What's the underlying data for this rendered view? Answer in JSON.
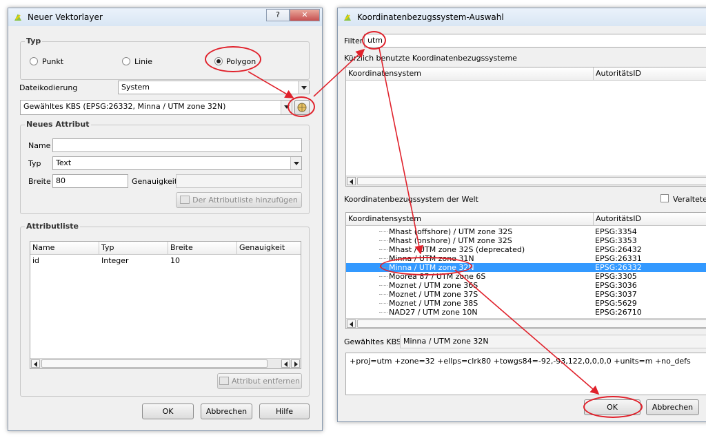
{
  "vector_dialog": {
    "title": "Neuer Vektorlayer",
    "help_glyph": "?",
    "close_glyph": "✕",
    "typ_group": "Typ",
    "types": [
      "Punkt",
      "Linie",
      "Polygon"
    ],
    "selected_type": "Polygon",
    "encoding_label": "Dateikodierung",
    "encoding_value": "System",
    "crs_value": "Gewähltes KBS (EPSG:26332, Minna / UTM zone 32N)",
    "new_attr_group": "Neues Attribut",
    "name_label": "Name",
    "name_value": "",
    "type_label": "Typ",
    "type_value": "Text",
    "width_label": "Breite",
    "width_value": "80",
    "precision_label": "Genauigkeit",
    "precision_value": "",
    "add_attr_button": "Der Attributliste hinzufügen",
    "attr_list_group": "Attributliste",
    "attr_columns": [
      "Name",
      "Typ",
      "Breite",
      "Genauigkeit"
    ],
    "attr_rows": [
      [
        "id",
        "Integer",
        "10",
        ""
      ]
    ],
    "remove_attr_button": "Attribut entfernen",
    "ok": "OK",
    "cancel": "Abbrechen",
    "help": "Hilfe"
  },
  "crs_dialog": {
    "title": "Koordinatenbezugssystem-Auswahl",
    "filter_label": "Filter",
    "filter_value": "utm",
    "recent_label": "Kürzlich benutzte Koordinatenbezugssysteme",
    "recent_columns": [
      "Koordinatensystem",
      "AutoritätsID"
    ],
    "world_label": "Koordinatenbezugssystem der Welt",
    "deprecated_label": "Veraltete K",
    "world_columns": [
      "Koordinatensystem",
      "AutoritätsID"
    ],
    "world_rows": [
      {
        "name": "Mhast (offshore) / UTM zone 32S",
        "id": "EPSG:3354",
        "selected": false
      },
      {
        "name": "Mhast (onshore) / UTM zone 32S",
        "id": "EPSG:3353",
        "selected": false
      },
      {
        "name": "Mhast / UTM zone 32S (deprecated)",
        "id": "EPSG:26432",
        "selected": false
      },
      {
        "name": "Minna / UTM zone 31N",
        "id": "EPSG:26331",
        "selected": false
      },
      {
        "name": "Minna / UTM zone 32N",
        "id": "EPSG:26332",
        "selected": true
      },
      {
        "name": "Moorea 87 / UTM zone 6S",
        "id": "EPSG:3305",
        "selected": false
      },
      {
        "name": "Moznet / UTM zone 36S",
        "id": "EPSG:3036",
        "selected": false
      },
      {
        "name": "Moznet / UTM zone 37S",
        "id": "EPSG:3037",
        "selected": false
      },
      {
        "name": "Moznet / UTM zone 38S",
        "id": "EPSG:5629",
        "selected": false
      },
      {
        "name": "NAD27 / UTM zone 10N",
        "id": "EPSG:26710",
        "selected": false
      }
    ],
    "selected_label": "Gewähltes KBS:",
    "selected_value": "Minna / UTM zone 32N",
    "proj_string": "+proj=utm +zone=32 +ellps=clrk80 +towgs84=-92,-93,122,0,0,0,0 +units=m +no_defs",
    "ok": "OK",
    "cancel": "Abbrechen"
  },
  "colors": {
    "annotation": "#e0212b",
    "selection": "#3399ff"
  }
}
